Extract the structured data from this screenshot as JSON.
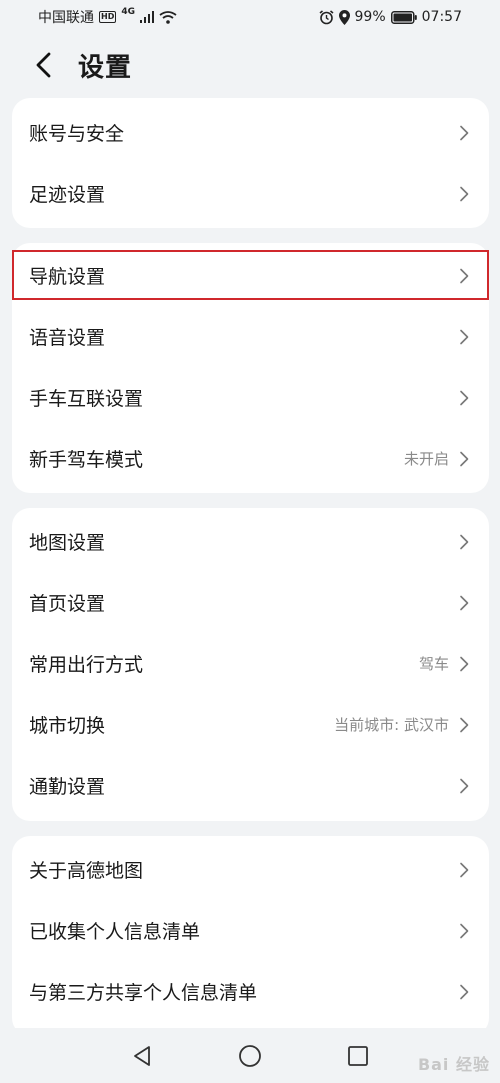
{
  "status_bar": {
    "carrier": "中国联通",
    "hd": "HD",
    "network": "4G",
    "battery_percent": "99%",
    "time": "07:57"
  },
  "header": {
    "title": "设置"
  },
  "groups": [
    {
      "items": [
        {
          "label": "账号与安全",
          "value": ""
        },
        {
          "label": "足迹设置",
          "value": ""
        }
      ]
    },
    {
      "items": [
        {
          "label": "导航设置",
          "value": ""
        },
        {
          "label": "语音设置",
          "value": ""
        },
        {
          "label": "手车互联设置",
          "value": ""
        },
        {
          "label": "新手驾车模式",
          "value": "未开启"
        }
      ]
    },
    {
      "items": [
        {
          "label": "地图设置",
          "value": ""
        },
        {
          "label": "首页设置",
          "value": ""
        },
        {
          "label": "常用出行方式",
          "value": "驾车"
        },
        {
          "label": "城市切换",
          "value": "当前城市: 武汉市"
        },
        {
          "label": "通勤设置",
          "value": ""
        }
      ]
    },
    {
      "items": [
        {
          "label": "关于高德地图",
          "value": ""
        },
        {
          "label": "已收集个人信息清单",
          "value": ""
        },
        {
          "label": "与第三方共享个人信息清单",
          "value": ""
        }
      ]
    }
  ],
  "watermark": "Bai 经验",
  "colors": {
    "background": "#f1f3f5",
    "card": "#ffffff",
    "highlight_border": "#d0282c",
    "secondary_text": "#8a8a8a"
  },
  "icons": {
    "back": "chevron-left-icon",
    "row_arrow": "chevron-right-icon",
    "nav_back": "triangle-back-icon",
    "nav_home": "circle-home-icon",
    "nav_recent": "square-recent-icon"
  }
}
